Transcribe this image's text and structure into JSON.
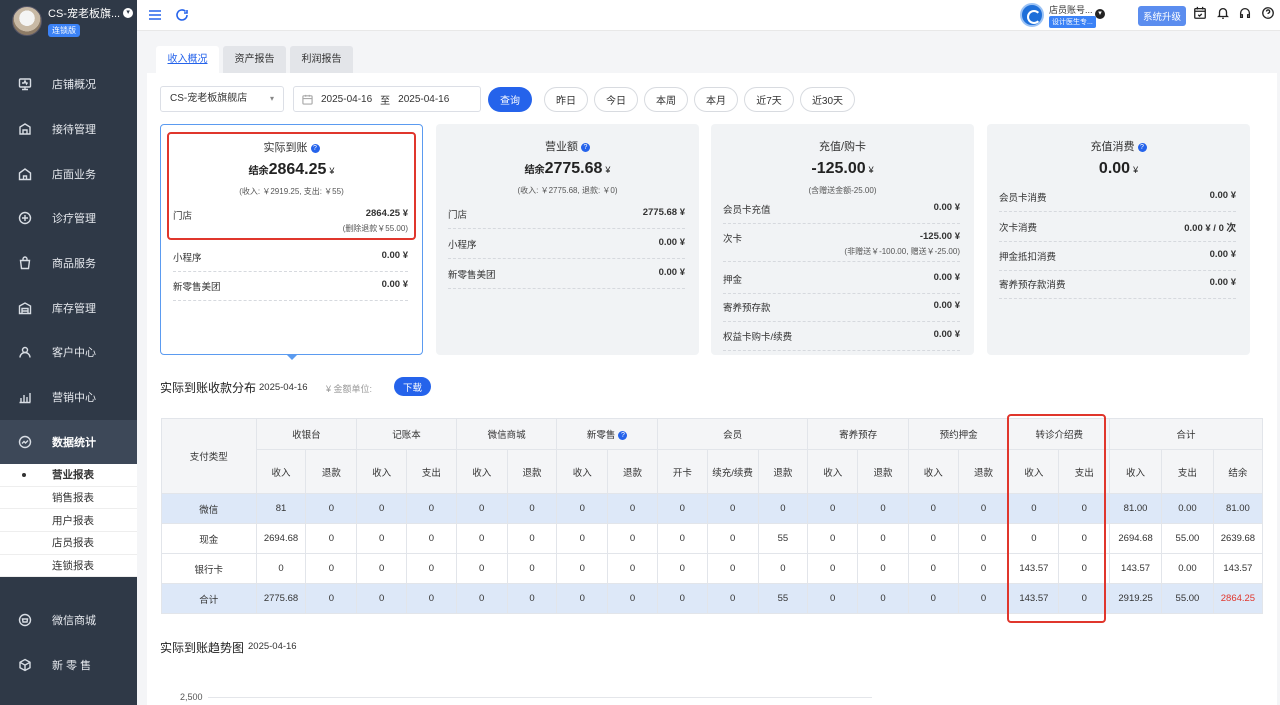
{
  "sidebar": {
    "store_name": "CS-宠老板旗...",
    "store_badge": "连锁版",
    "items": [
      {
        "label": "店铺概况",
        "icon": "monitor-icon"
      },
      {
        "label": "接待管理",
        "icon": "reception-icon"
      },
      {
        "label": "店面业务",
        "icon": "store-icon"
      },
      {
        "label": "诊疗管理",
        "icon": "medical-icon"
      },
      {
        "label": "商品服务",
        "icon": "shopping-bag-icon"
      },
      {
        "label": "库存管理",
        "icon": "warehouse-icon"
      },
      {
        "label": "客户中心",
        "icon": "customer-icon"
      },
      {
        "label": "营销中心",
        "icon": "marketing-icon"
      },
      {
        "label": "数据统计",
        "icon": "chart-icon"
      }
    ],
    "subitems": [
      "营业报表",
      "销售报表",
      "用户报表",
      "店员报表",
      "连锁报表"
    ],
    "items_after": [
      {
        "label": "微信商城",
        "icon": "wechat-mall-icon"
      },
      {
        "label": "新 零 售",
        "icon": "new-retail-icon"
      }
    ]
  },
  "topbar": {
    "account_name": "店员账号...",
    "account_tag": "设计医生专...",
    "upgrade_label": "系统升级"
  },
  "tabs": [
    "收入概况",
    "资产报告",
    "利润报告"
  ],
  "filters": {
    "store": "CS-宠老板旗舰店",
    "date_start": "2025-04-16",
    "date_sep": "至",
    "date_end": "2025-04-16",
    "query_label": "查询",
    "quick": [
      "昨日",
      "今日",
      "本周",
      "本月",
      "近7天",
      "近30天"
    ]
  },
  "cards": [
    {
      "title": "实际到账",
      "prefix": "结余",
      "value": "2864.25",
      "unit": "¥",
      "sub": "(收入: ￥2919.25, 支出: ￥55)",
      "rows": [
        {
          "label": "门店",
          "value": "2864.25 ¥",
          "note": "(删除退款￥55.00)"
        },
        {
          "label": "小程序",
          "value": "0.00 ¥"
        },
        {
          "label": "新零售美团",
          "value": "0.00 ¥"
        }
      ]
    },
    {
      "title": "营业额",
      "prefix": "结余",
      "value": "2775.68",
      "unit": "¥",
      "sub": "(收入: ￥2775.68, 退款: ￥0)",
      "rows": [
        {
          "label": "门店",
          "value": "2775.68 ¥"
        },
        {
          "label": "小程序",
          "value": "0.00 ¥"
        },
        {
          "label": "新零售美团",
          "value": "0.00 ¥"
        }
      ]
    },
    {
      "title": "充值/购卡",
      "prefix": "",
      "value": "-125.00",
      "unit": "¥",
      "sub": "(含赠送金额-25.00)",
      "rows": [
        {
          "label": "会员卡充值",
          "value": "0.00 ¥"
        },
        {
          "label": "次卡",
          "value": "-125.00 ¥",
          "note": "(非赠送￥-100.00, 赠送￥-25.00)"
        },
        {
          "label": "押金",
          "value": "0.00 ¥"
        },
        {
          "label": "寄养预存款",
          "value": "0.00 ¥"
        },
        {
          "label": "权益卡购卡/续费",
          "value": "0.00 ¥"
        }
      ]
    },
    {
      "title": "充值消费",
      "prefix": "",
      "value": "0.00",
      "unit": "¥",
      "sub": "",
      "rows": [
        {
          "label": "会员卡消费",
          "value": "0.00 ¥"
        },
        {
          "label": "次卡消费",
          "value": "0.00 ¥ / 0 次"
        },
        {
          "label": "押金抵扣消费",
          "value": "0.00 ¥"
        },
        {
          "label": "寄养预存款消费",
          "value": "0.00 ¥"
        }
      ]
    }
  ],
  "distribution": {
    "title": "实际到账收款分布",
    "date": "2025-04-16",
    "unit_label": "¥ 金额单位:",
    "download_label": "下载",
    "table": {
      "type_header": "支付类型",
      "groups": [
        {
          "name": "收银台",
          "cols": [
            "收入",
            "退款"
          ]
        },
        {
          "name": "记账本",
          "cols": [
            "收入",
            "支出"
          ]
        },
        {
          "name": "微信商城",
          "cols": [
            "收入",
            "退款"
          ]
        },
        {
          "name": "新零售",
          "cols": [
            "收入",
            "退款"
          ]
        },
        {
          "name": "会员",
          "cols": [
            "开卡",
            "续充/续费",
            "退款"
          ]
        },
        {
          "name": "寄养预存",
          "cols": [
            "收入",
            "退款"
          ]
        },
        {
          "name": "预约押金",
          "cols": [
            "收入",
            "退款"
          ]
        },
        {
          "name": "转诊介绍费",
          "cols": [
            "收入",
            "支出"
          ]
        },
        {
          "name": "合计",
          "cols": [
            "收入",
            "支出",
            "结余"
          ]
        }
      ],
      "rows": [
        {
          "name": "微信",
          "cells": [
            "81",
            "0",
            "0",
            "0",
            "0",
            "0",
            "0",
            "0",
            "0",
            "0",
            "0",
            "0",
            "0",
            "0",
            "0",
            "0",
            "0",
            "81.00",
            "0.00",
            "81.00"
          ]
        },
        {
          "name": "现金",
          "cells": [
            "2694.68",
            "0",
            "0",
            "0",
            "0",
            "0",
            "0",
            "0",
            "0",
            "0",
            "55",
            "0",
            "0",
            "0",
            "0",
            "0",
            "0",
            "2694.68",
            "55.00",
            "2639.68"
          ]
        },
        {
          "name": "银行卡",
          "cells": [
            "0",
            "0",
            "0",
            "0",
            "0",
            "0",
            "0",
            "0",
            "0",
            "0",
            "0",
            "0",
            "0",
            "0",
            "0",
            "143.57",
            "0",
            "143.57",
            "0.00",
            "143.57"
          ]
        },
        {
          "name": "合计",
          "cells": [
            "2775.68",
            "0",
            "0",
            "0",
            "0",
            "0",
            "0",
            "0",
            "0",
            "0",
            "55",
            "0",
            "0",
            "0",
            "0",
            "143.57",
            "0",
            "2919.25",
            "55.00",
            "2864.25"
          ]
        }
      ]
    }
  },
  "trend": {
    "title": "实际到账趋势图",
    "date": "2025-04-16",
    "y_tick": "2,500"
  }
}
